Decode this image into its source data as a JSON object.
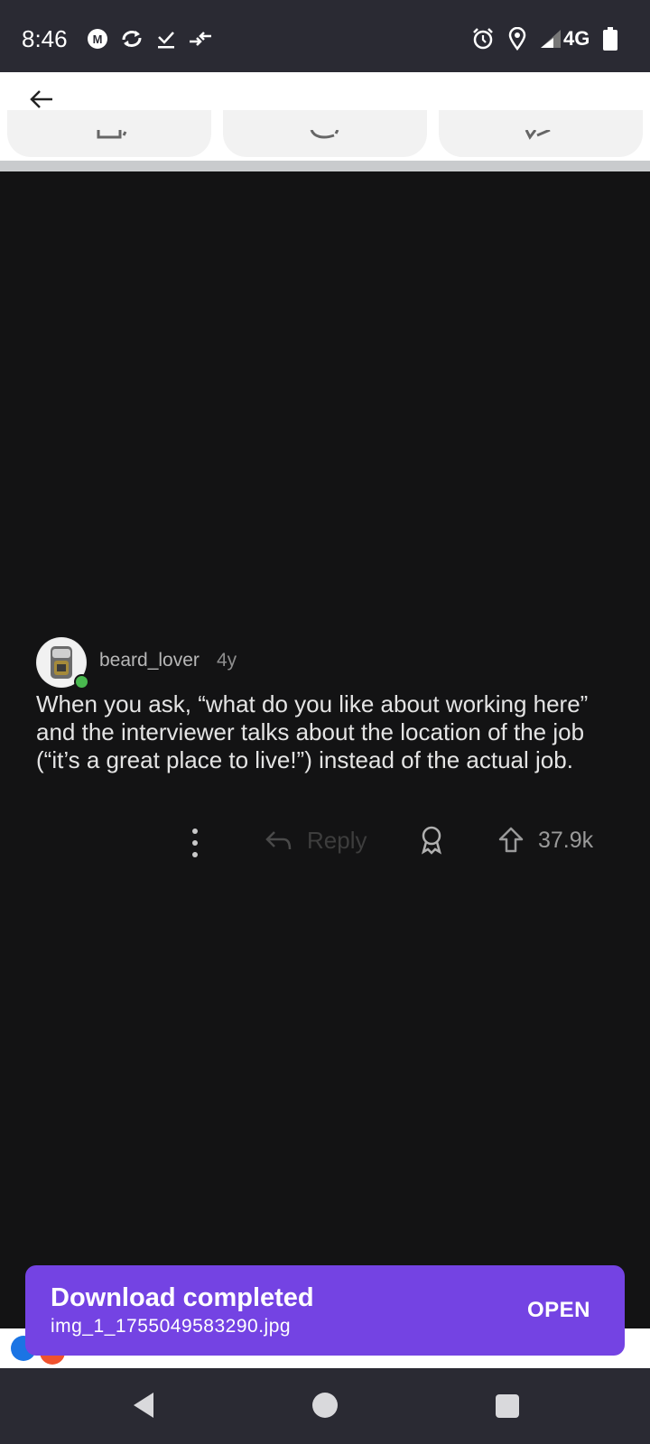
{
  "status_bar": {
    "time": "8:46",
    "network": "4G",
    "icons": [
      "mail-badge-icon",
      "sync-icon",
      "download-done-icon",
      "arrows-icon",
      "alarm-icon",
      "location-icon",
      "signal-icon",
      "battery-icon"
    ]
  },
  "top_bar": {
    "back_icon": "arrow-left-icon"
  },
  "post_actions": [
    "upvote-tab-icon",
    "comment-tab-icon",
    "share-tab-icon"
  ],
  "comment": {
    "username": "beard_lover",
    "age": "4y",
    "text": "When you ask, “what do you like about working here” and the interviewer talks about the location of the job (“it’s a great place to live!”) instead of the actual job.",
    "reply_label": "Reply",
    "votes": "37.9k"
  },
  "toast": {
    "title": "Download completed",
    "filename": "img_1_1755049583290.jpg",
    "action": "OPEN"
  },
  "colors": {
    "accent": "#7443e3",
    "viewer_bg": "#131314",
    "online": "#49b84f"
  }
}
